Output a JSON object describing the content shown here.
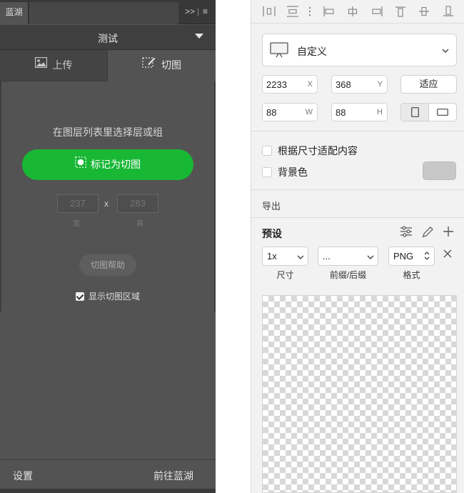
{
  "lanhu": {
    "panel_tab": "蓝湖",
    "tab_controls": {
      "collapse": ">>",
      "menu": "≡"
    },
    "project_name": "测试",
    "modes": {
      "upload": "上传",
      "slice": "切图"
    },
    "hint": "在图层列表里选择层或组",
    "mark_button": "标记为切图",
    "width_placeholder": "237",
    "height_placeholder": "283",
    "times": "x",
    "width_label": "宽",
    "height_label": "高",
    "help_button": "切图帮助",
    "show_area": {
      "label": "显示切图区域",
      "checked": true
    },
    "footer": {
      "settings": "设置",
      "goto": "前往蓝湖"
    },
    "colors": {
      "panel": "#535353",
      "accent": "#18b835"
    }
  },
  "inspector": {
    "artboard_preset": "自定义",
    "x": {
      "value": "2233",
      "unit": "X"
    },
    "y": {
      "value": "368",
      "unit": "Y"
    },
    "fit_button": "适应",
    "w": {
      "value": "88",
      "unit": "W"
    },
    "h": {
      "value": "88",
      "unit": "H"
    },
    "orientation": [
      "portrait-icon",
      "landscape-icon"
    ],
    "resize_to_fit": {
      "label": "根据尺寸适配内容",
      "checked": false
    },
    "background_color": {
      "label": "背景色",
      "checked": false,
      "swatch": "#c8c8c8"
    },
    "export_heading": "导出",
    "presets_heading": "预设",
    "export_row": {
      "size": "1x",
      "suffix": "...",
      "format": "PNG",
      "size_caption": "尺寸",
      "suffix_caption": "前缀/后缀",
      "format_caption": "格式"
    }
  }
}
